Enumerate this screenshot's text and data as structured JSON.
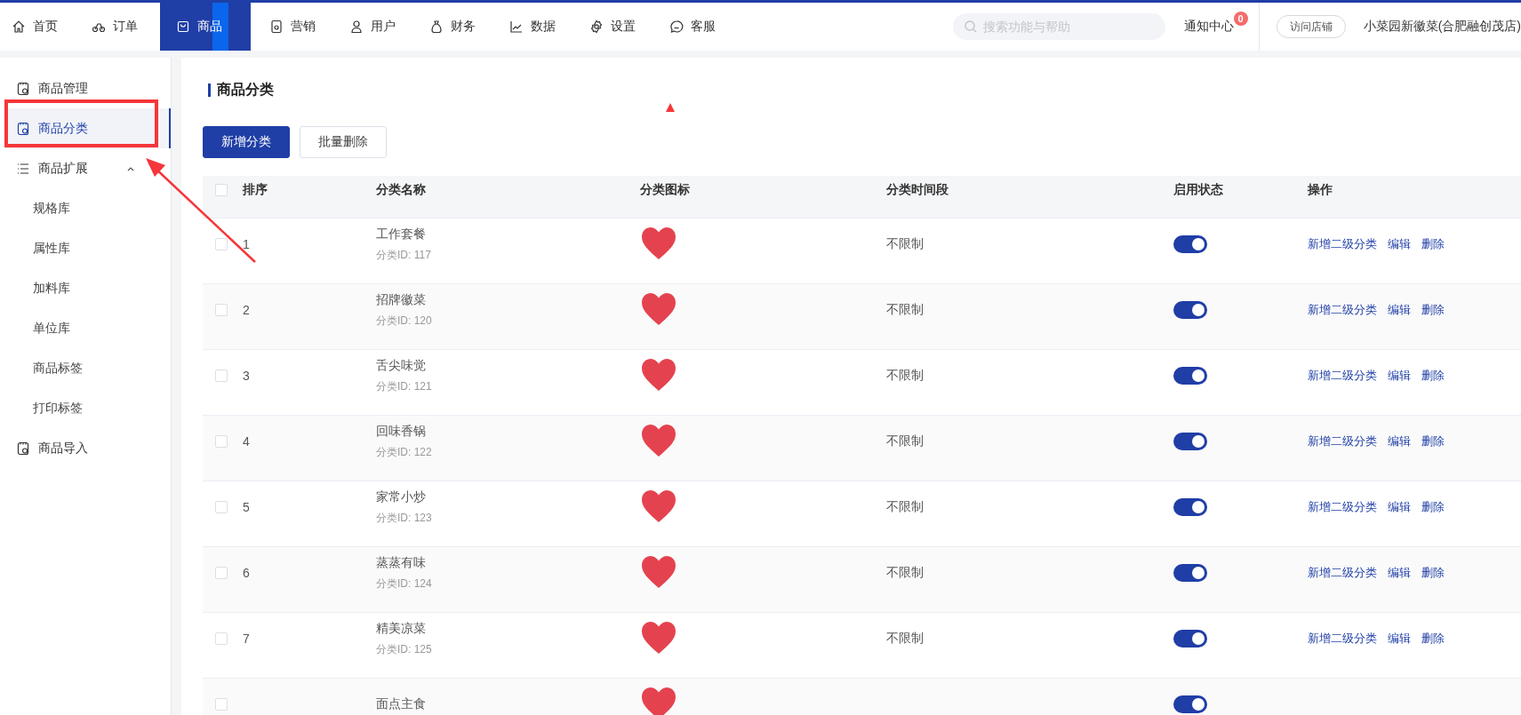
{
  "nav": {
    "items": [
      {
        "label": "首页",
        "selected": false
      },
      {
        "label": "订单",
        "selected": false
      },
      {
        "label": "商品",
        "selected": true
      },
      {
        "label": "营销",
        "selected": false
      },
      {
        "label": "用户",
        "selected": false
      },
      {
        "label": "财务",
        "selected": false
      },
      {
        "label": "数据",
        "selected": false
      },
      {
        "label": "设置",
        "selected": false
      },
      {
        "label": "客服",
        "selected": false
      }
    ],
    "search": {
      "placeholder": "搜索功能与帮助"
    },
    "notifications": {
      "label": "通知中心",
      "badge": "0"
    },
    "visit_button": "访问店铺",
    "store_name": "小菜园新徽菜(合肥融创茂店)"
  },
  "sidebar": {
    "items": [
      {
        "kind": "item",
        "label": "商品管理",
        "selected": false
      },
      {
        "kind": "item",
        "label": "商品分类",
        "selected": true
      },
      {
        "kind": "group",
        "label": "商品扩展",
        "expanded": true,
        "children": [
          {
            "label": "规格库"
          },
          {
            "label": "属性库"
          },
          {
            "label": "加料库"
          },
          {
            "label": "单位库"
          },
          {
            "label": "商品标签"
          },
          {
            "label": "打印标签"
          }
        ]
      },
      {
        "kind": "item",
        "label": "商品导入",
        "selected": false
      }
    ]
  },
  "page": {
    "title": "商品分类",
    "buttons": [
      {
        "kind": "primary",
        "label": "新增分类"
      },
      {
        "kind": "default",
        "label": "批量删除"
      }
    ]
  },
  "table": {
    "select_all_checked": false,
    "columns": [
      "排序",
      "分类名称",
      "分类图标",
      "分类时间段",
      "启用状态",
      "操作"
    ],
    "rows": [
      {
        "checked": false,
        "rank": "1",
        "name": "工作套餐",
        "id": "分类ID: 117",
        "period": "不限制",
        "enabled": true,
        "actions": [
          "新增二级分类",
          "编辑",
          "删除"
        ]
      },
      {
        "checked": false,
        "rank": "2",
        "name": "招牌徽菜",
        "id": "分类ID: 120",
        "period": "不限制",
        "enabled": true,
        "actions": [
          "新增二级分类",
          "编辑",
          "删除"
        ]
      },
      {
        "checked": false,
        "rank": "3",
        "name": "舌尖味觉",
        "id": "分类ID: 121",
        "period": "不限制",
        "enabled": true,
        "actions": [
          "新增二级分类",
          "编辑",
          "删除"
        ]
      },
      {
        "checked": false,
        "rank": "4",
        "name": "回味香锅",
        "id": "分类ID: 122",
        "period": "不限制",
        "enabled": true,
        "actions": [
          "新增二级分类",
          "编辑",
          "删除"
        ]
      },
      {
        "checked": false,
        "rank": "5",
        "name": "家常小炒",
        "id": "分类ID: 123",
        "period": "不限制",
        "enabled": true,
        "actions": [
          "新增二级分类",
          "编辑",
          "删除"
        ]
      },
      {
        "checked": false,
        "rank": "6",
        "name": "蒸蒸有味",
        "id": "分类ID: 124",
        "period": "不限制",
        "enabled": true,
        "actions": [
          "新增二级分类",
          "编辑",
          "删除"
        ]
      },
      {
        "checked": false,
        "rank": "7",
        "name": "精美凉菜",
        "id": "分类ID: 125",
        "period": "不限制",
        "enabled": true,
        "actions": [
          "新增二级分类",
          "编辑",
          "删除"
        ]
      },
      {
        "checked": false,
        "name": "面点主食",
        "enabled": true
      }
    ]
  }
}
